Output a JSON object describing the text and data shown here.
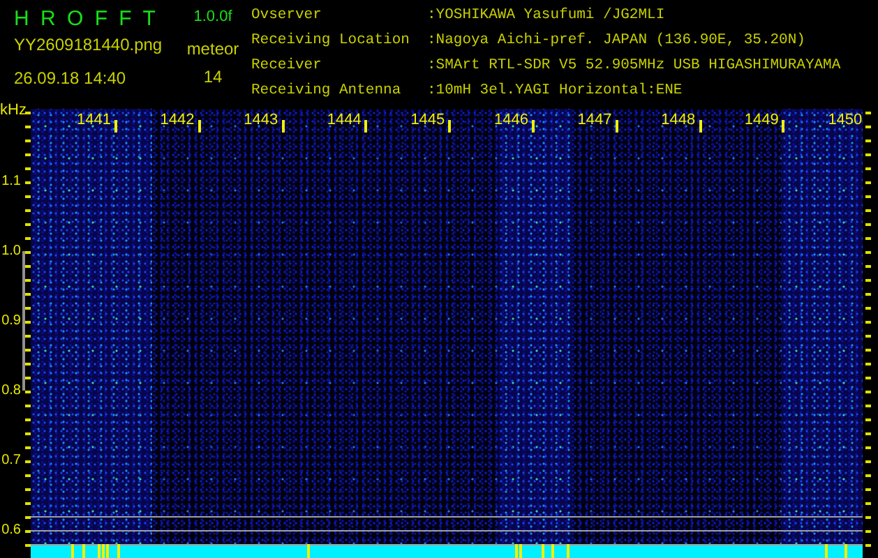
{
  "app": {
    "title": "H R O F F T",
    "version": "1.0.0f"
  },
  "file": {
    "name": "YY2609181440.png",
    "datetime": "26.09.18 14:40"
  },
  "meteor": {
    "label": "meteor",
    "count": "14"
  },
  "info": [
    {
      "label": "Ovserver",
      "value": ":YOSHIKAWA Yasufumi /JG2MLI"
    },
    {
      "label": "Receiving Location",
      "value": ":Nagoya Aichi-pref. JAPAN (136.90E, 35.20N)"
    },
    {
      "label": "Receiver",
      "value": ":SMArt RTL-SDR V5 52.905MHz USB HIGASHIMURAYAMA"
    },
    {
      "label": "Receiving Antenna",
      "value": ":10mH 3el.YAGI Horizontal:ENE"
    }
  ],
  "spectrogram": {
    "unit": "kHz",
    "x_labels": [
      "1441",
      "1442",
      "1443",
      "1444",
      "1445",
      "1446",
      "1447",
      "1448",
      "1449",
      "1450"
    ],
    "y_labels": [
      "1.1",
      "1.0",
      "0.9",
      "0.8",
      "0.7",
      "0.6"
    ]
  }
}
